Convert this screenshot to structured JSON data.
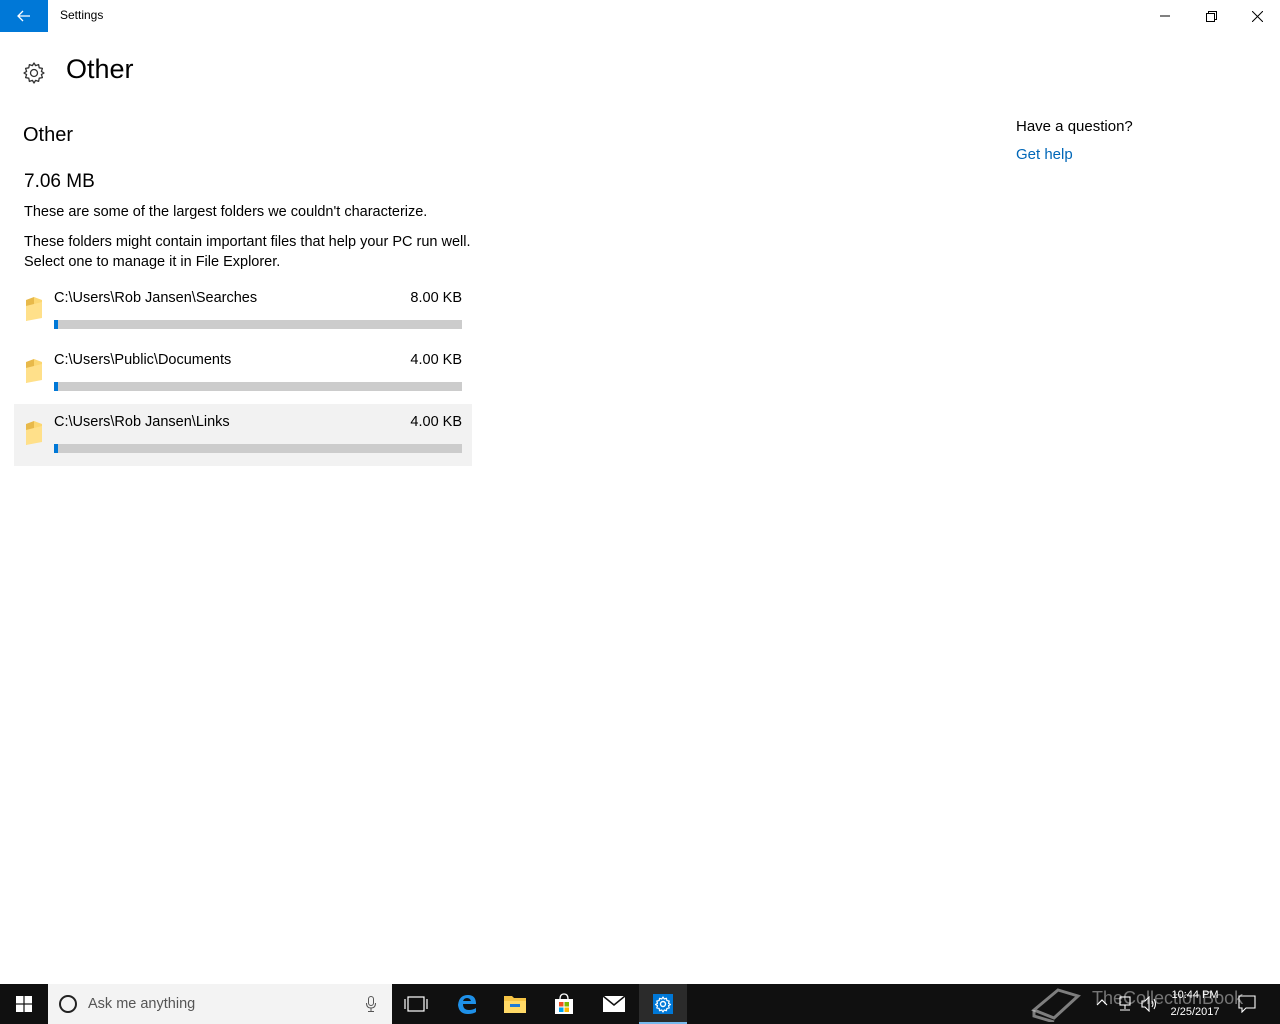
{
  "window": {
    "title": "Settings",
    "back_icon": "arrow-left-icon",
    "controls": [
      "minimize-icon",
      "restore-icon",
      "close-icon"
    ]
  },
  "header": {
    "icon": "gear-icon",
    "title": "Other"
  },
  "main": {
    "section_title": "Other",
    "total_size": "7.06 MB",
    "description_1": "These are some of the largest folders we couldn't characterize.",
    "description_2": "These folders might contain important files that help your PC run well. Select one to manage it in File Explorer.",
    "folders": [
      {
        "path": "C:\\Users\\Rob Jansen\\Searches",
        "size": "8.00 KB",
        "usage_fraction": 0.01
      },
      {
        "path": "C:\\Users\\Public\\Documents",
        "size": "4.00 KB",
        "usage_fraction": 0.01
      },
      {
        "path": "C:\\Users\\Rob Jansen\\Links",
        "size": "4.00 KB",
        "usage_fraction": 0.01
      }
    ]
  },
  "help": {
    "question": "Have a question?",
    "link": "Get help"
  },
  "taskbar": {
    "search_placeholder": "Ask me anything",
    "time": "10:44 PM",
    "date": "2/25/2017",
    "watermark": "TheCollectionBook",
    "pinned": [
      "task-view-icon",
      "edge-icon",
      "file-explorer-icon",
      "store-icon",
      "mail-icon",
      "settings-icon"
    ],
    "active": "settings-icon"
  },
  "colors": {
    "accent": "#0078d7",
    "link": "#0067b8",
    "bar_track": "#cccccc",
    "taskbar": "#101010"
  }
}
